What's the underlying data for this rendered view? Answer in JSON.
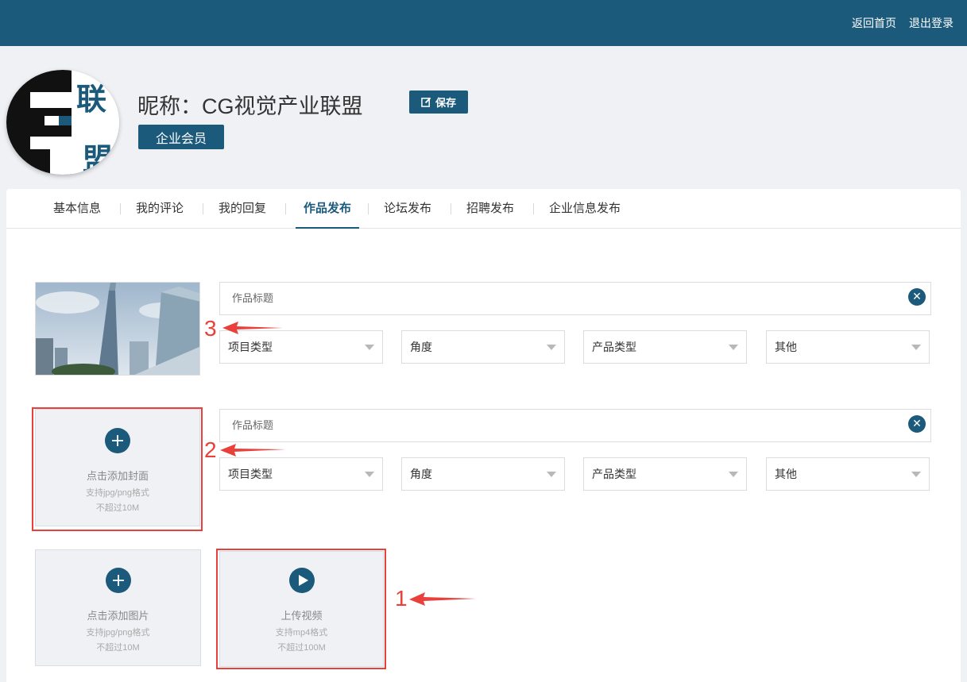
{
  "header": {
    "home_link": "返回首页",
    "logout_link": "退出登录"
  },
  "profile": {
    "avatar_text_top": "联",
    "avatar_text_bottom": "盟",
    "nickname": "昵称：CG视觉产业联盟",
    "save_label": "保存",
    "member_badge": "企业会员"
  },
  "tabs": [
    {
      "label": "基本信息"
    },
    {
      "label": "我的评论"
    },
    {
      "label": "我的回复"
    },
    {
      "label": "作品发布",
      "active": true
    },
    {
      "label": "论坛发布"
    },
    {
      "label": "招聘发布"
    },
    {
      "label": "企业信息发布"
    }
  ],
  "works": [
    {
      "title_placeholder": "作品标题",
      "selects": [
        "项目类型",
        "角度",
        "产品类型",
        "其他"
      ]
    },
    {
      "title_placeholder": "作品标题",
      "selects": [
        "项目类型",
        "角度",
        "产品类型",
        "其他"
      ]
    }
  ],
  "uploads": {
    "cover": {
      "title": "点击添加封面",
      "format": "支持jpg/png格式",
      "limit": "不超过10M"
    },
    "image": {
      "title": "点击添加图片",
      "format": "支持jpg/png格式",
      "limit": "不超过10M"
    },
    "video": {
      "title": "上传视频",
      "format": "支持mp4格式",
      "limit": "不超过100M"
    }
  },
  "annotations": {
    "label_1": "1",
    "label_2": "2",
    "label_3": "3"
  },
  "colors": {
    "brand": "#1c5a7c",
    "annotation": "#e9403b",
    "page_bg": "#f0f1f5"
  }
}
